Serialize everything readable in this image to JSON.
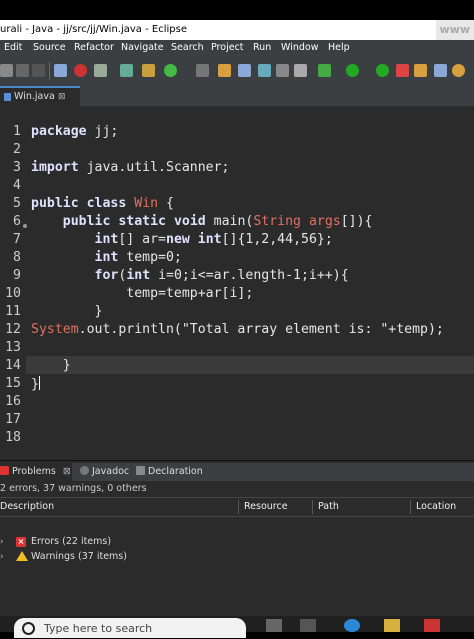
{
  "window": {
    "title": "urali - Java - jj/src/jj/Win.java - Eclipse",
    "watermark": "www"
  },
  "menu": [
    "Edit",
    "Source",
    "Refactor",
    "Navigate",
    "Search",
    "Project",
    "Run",
    "Window",
    "Help"
  ],
  "toolbar_icons": [
    "new-icon",
    "save-icon",
    "print-icon",
    "debug-icon",
    "skip-breakpoints-icon",
    "new-class-icon",
    "run-icon",
    "run-dropdown-icon",
    "open-type-icon",
    "search-icon",
    "pencil-icon",
    "task-icon",
    "annotation-icon",
    "bug-icon",
    "coverage-icon",
    "external-tools-icon",
    "perspective-icon",
    "quick-access-icon"
  ],
  "editor": {
    "tab_label": "Win.java",
    "tab_close": "⊠",
    "line_numbers": [
      "1",
      "2",
      "3",
      "4",
      "5",
      "6",
      "7",
      "8",
      "9",
      "10",
      "11",
      "12",
      "13",
      "14",
      "15",
      "16",
      "17",
      "18"
    ]
  },
  "problems": {
    "tabs": [
      {
        "label": "Problems",
        "close": "⊠"
      },
      {
        "label": "Javadoc"
      },
      {
        "label": "Declaration"
      }
    ],
    "summary": "2 errors, 37 warnings, 0 others",
    "columns": [
      "Description",
      "Resource",
      "Path",
      "Location"
    ],
    "rows": [
      {
        "label": "Errors (22 items)",
        "kind": "error"
      },
      {
        "label": "Warnings (37 items)",
        "kind": "warning"
      }
    ]
  },
  "taskbar": {
    "search_placeholder": "Type here to search"
  },
  "colors": {
    "editor_bg": "#2b2b2b",
    "keyword": "#e0e0ff",
    "class_name": "#e07060",
    "error": "#dd3333",
    "warning": "#f0c020"
  }
}
